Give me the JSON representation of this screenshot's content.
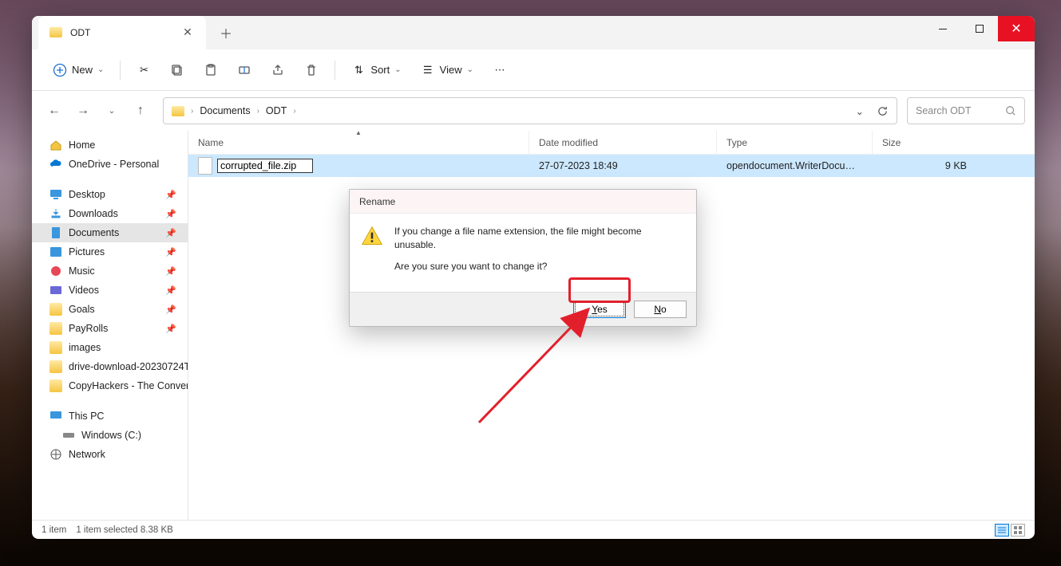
{
  "tab": {
    "title": "ODT"
  },
  "toolbar": {
    "new": "New",
    "sort": "Sort",
    "view": "View"
  },
  "breadcrumbs": [
    "Documents",
    "ODT"
  ],
  "search": {
    "placeholder": "Search ODT"
  },
  "sidebar": {
    "home": "Home",
    "onedrive": "OneDrive - Personal",
    "desktop": "Desktop",
    "downloads": "Downloads",
    "documents": "Documents",
    "pictures": "Pictures",
    "music": "Music",
    "videos": "Videos",
    "goals": "Goals",
    "payrolls": "PayRolls",
    "images": "images",
    "drivedl": "drive-download-20230724T",
    "copyhackers": "CopyHackers - The Conversi",
    "thispc": "This PC",
    "windowsc": "Windows (C:)",
    "network": "Network"
  },
  "columns": {
    "name": "Name",
    "date": "Date modified",
    "type": "Type",
    "size": "Size"
  },
  "file": {
    "rename_value": "corrupted_file.zip",
    "date": "27-07-2023 18:49",
    "type": "opendocument.WriterDocumen...",
    "size": "9 KB"
  },
  "dialog": {
    "title": "Rename",
    "line1": "If you change a file name extension, the file might become unusable.",
    "line2": "Are you sure you want to change it?",
    "yes": "Yes",
    "no": "No"
  },
  "status": {
    "count": "1 item",
    "selected": "1 item selected  8.38 KB"
  }
}
